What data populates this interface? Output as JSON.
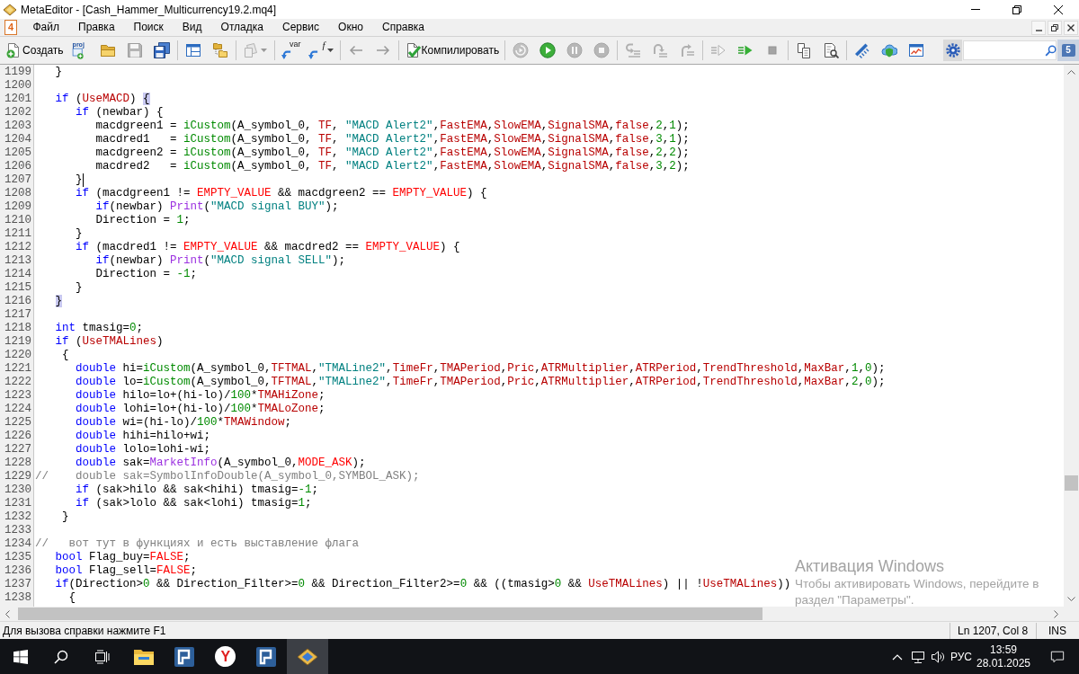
{
  "window": {
    "title": "MetaEditor - [Cash_Hammer_Multicurrency19.2.mq4]"
  },
  "menu_bar": {
    "document_glyph": "4",
    "items": [
      "Файл",
      "Правка",
      "Поиск",
      "Вид",
      "Отладка",
      "Сервис",
      "Окно",
      "Справка"
    ]
  },
  "toolbar": {
    "groups": [
      [
        {
          "kind": "new",
          "label": "Создать",
          "disabled": false
        },
        {
          "kind": "project",
          "glyph": "proj",
          "disabled": false
        },
        {
          "kind": "open",
          "disabled": false
        },
        {
          "kind": "save",
          "disabled": true
        },
        {
          "kind": "saveall",
          "disabled": false
        }
      ],
      [
        {
          "kind": "navigator",
          "disabled": false
        },
        {
          "kind": "folders",
          "disabled": false
        }
      ],
      [
        {
          "kind": "clipboard",
          "disabled": true
        }
      ],
      [
        {
          "kind": "variable",
          "glyph": "var",
          "disabled": false
        },
        {
          "kind": "function",
          "glyph": "f",
          "disabled": false
        }
      ],
      [
        {
          "kind": "back",
          "disabled": true
        },
        {
          "kind": "forward",
          "disabled": true
        }
      ],
      [
        {
          "kind": "compile",
          "label": "Компилировать",
          "disabled": false
        }
      ],
      [
        {
          "kind": "restart",
          "disabled": true
        },
        {
          "kind": "start",
          "disabled": false
        },
        {
          "kind": "pause",
          "disabled": true
        },
        {
          "kind": "stop",
          "disabled": true
        }
      ],
      [
        {
          "kind": "stepinto",
          "disabled": true
        },
        {
          "kind": "stepover",
          "disabled": true
        },
        {
          "kind": "stepout",
          "disabled": true
        }
      ],
      [
        {
          "kind": "profile",
          "disabled": true
        },
        {
          "kind": "run",
          "disabled": false
        },
        {
          "kind": "halt",
          "disabled": true
        }
      ],
      [
        {
          "kind": "copy",
          "disabled": false
        },
        {
          "kind": "inspect",
          "disabled": false
        }
      ],
      [
        {
          "kind": "styler",
          "disabled": false
        },
        {
          "kind": "cloud",
          "disabled": false
        },
        {
          "kind": "chart",
          "disabled": false
        }
      ]
    ],
    "chat_glyph": "5"
  },
  "editor": {
    "lines": [
      {
        "number": "1199",
        "tokens": [
          {
            "text": "   }",
            "kind": "plain"
          }
        ]
      },
      {
        "number": "1200"
      },
      {
        "number": "1201",
        "tokens": [
          {
            "text": "   if",
            "kind": "keyword"
          },
          {
            "text": " (",
            "kind": "plain"
          },
          {
            "text": "UseMACD",
            "kind": "param"
          },
          {
            "text": ") ",
            "kind": "plain"
          },
          {
            "text": "{",
            "kind": "brace_match"
          }
        ]
      },
      {
        "number": "1202",
        "tokens": [
          {
            "text": "      if",
            "kind": "keyword"
          },
          {
            "text": " (newbar) {",
            "kind": "plain"
          }
        ]
      },
      {
        "number": "1203",
        "tokens": [
          {
            "text": "         macdgreen1 = ",
            "kind": "plain"
          },
          {
            "text": "iCustom",
            "kind": "function"
          },
          {
            "text": "(A_symbol_0, ",
            "kind": "plain"
          },
          {
            "text": "TF",
            "kind": "param"
          },
          {
            "text": ", ",
            "kind": "plain"
          },
          {
            "text": "\"MACD Alert2\"",
            "kind": "string"
          },
          {
            "text": ",",
            "kind": "plain"
          },
          {
            "text": "FastEMA",
            "kind": "param"
          },
          {
            "text": ",",
            "kind": "plain"
          },
          {
            "text": "SlowEMA",
            "kind": "param"
          },
          {
            "text": ",",
            "kind": "plain"
          },
          {
            "text": "SignalSMA",
            "kind": "param"
          },
          {
            "text": ",",
            "kind": "plain"
          },
          {
            "text": "false",
            "kind": "param"
          },
          {
            "text": ",",
            "kind": "plain"
          },
          {
            "text": "2",
            "kind": "number"
          },
          {
            "text": ",",
            "kind": "plain"
          },
          {
            "text": "1",
            "kind": "number"
          },
          {
            "text": ");",
            "kind": "plain"
          }
        ]
      },
      {
        "number": "1204",
        "tokens": [
          {
            "text": "         macdred1   = ",
            "kind": "plain"
          },
          {
            "text": "iCustom",
            "kind": "function"
          },
          {
            "text": "(A_symbol_0, ",
            "kind": "plain"
          },
          {
            "text": "TF",
            "kind": "param"
          },
          {
            "text": ", ",
            "kind": "plain"
          },
          {
            "text": "\"MACD Alert2\"",
            "kind": "string"
          },
          {
            "text": ",",
            "kind": "plain"
          },
          {
            "text": "FastEMA",
            "kind": "param"
          },
          {
            "text": ",",
            "kind": "plain"
          },
          {
            "text": "SlowEMA",
            "kind": "param"
          },
          {
            "text": ",",
            "kind": "plain"
          },
          {
            "text": "SignalSMA",
            "kind": "param"
          },
          {
            "text": ",",
            "kind": "plain"
          },
          {
            "text": "false",
            "kind": "param"
          },
          {
            "text": ",",
            "kind": "plain"
          },
          {
            "text": "3",
            "kind": "number"
          },
          {
            "text": ",",
            "kind": "plain"
          },
          {
            "text": "1",
            "kind": "number"
          },
          {
            "text": ");",
            "kind": "plain"
          }
        ]
      },
      {
        "number": "1205",
        "tokens": [
          {
            "text": "         macdgreen2 = ",
            "kind": "plain"
          },
          {
            "text": "iCustom",
            "kind": "function"
          },
          {
            "text": "(A_symbol_0, ",
            "kind": "plain"
          },
          {
            "text": "TF",
            "kind": "param"
          },
          {
            "text": ", ",
            "kind": "plain"
          },
          {
            "text": "\"MACD Alert2\"",
            "kind": "string"
          },
          {
            "text": ",",
            "kind": "plain"
          },
          {
            "text": "FastEMA",
            "kind": "param"
          },
          {
            "text": ",",
            "kind": "plain"
          },
          {
            "text": "SlowEMA",
            "kind": "param"
          },
          {
            "text": ",",
            "kind": "plain"
          },
          {
            "text": "SignalSMA",
            "kind": "param"
          },
          {
            "text": ",",
            "kind": "plain"
          },
          {
            "text": "false",
            "kind": "param"
          },
          {
            "text": ",",
            "kind": "plain"
          },
          {
            "text": "2",
            "kind": "number"
          },
          {
            "text": ",",
            "kind": "plain"
          },
          {
            "text": "2",
            "kind": "number"
          },
          {
            "text": ");",
            "kind": "plain"
          }
        ]
      },
      {
        "number": "1206",
        "tokens": [
          {
            "text": "         macdred2   = ",
            "kind": "plain"
          },
          {
            "text": "iCustom",
            "kind": "function"
          },
          {
            "text": "(A_symbol_0, ",
            "kind": "plain"
          },
          {
            "text": "TF",
            "kind": "param"
          },
          {
            "text": ", ",
            "kind": "plain"
          },
          {
            "text": "\"MACD Alert2\"",
            "kind": "string"
          },
          {
            "text": ",",
            "kind": "plain"
          },
          {
            "text": "FastEMA",
            "kind": "param"
          },
          {
            "text": ",",
            "kind": "plain"
          },
          {
            "text": "SlowEMA",
            "kind": "param"
          },
          {
            "text": ",",
            "kind": "plain"
          },
          {
            "text": "SignalSMA",
            "kind": "param"
          },
          {
            "text": ",",
            "kind": "plain"
          },
          {
            "text": "false",
            "kind": "param"
          },
          {
            "text": ",",
            "kind": "plain"
          },
          {
            "text": "3",
            "kind": "number"
          },
          {
            "text": ",",
            "kind": "plain"
          },
          {
            "text": "2",
            "kind": "number"
          },
          {
            "text": ");",
            "kind": "plain"
          }
        ]
      },
      {
        "number": "1207",
        "tokens": [
          {
            "text": "      }",
            "kind": "plain"
          },
          {
            "kind": "caret"
          }
        ]
      },
      {
        "number": "1208",
        "tokens": [
          {
            "text": "      if",
            "kind": "keyword"
          },
          {
            "text": " (macdgreen1 != ",
            "kind": "plain"
          },
          {
            "text": "EMPTY_VALUE",
            "kind": "constant"
          },
          {
            "text": " && macdgreen2 == ",
            "kind": "plain"
          },
          {
            "text": "EMPTY_VALUE",
            "kind": "constant"
          },
          {
            "text": ") {",
            "kind": "plain"
          }
        ]
      },
      {
        "number": "1209",
        "tokens": [
          {
            "text": "         if",
            "kind": "keyword"
          },
          {
            "text": "(newbar) ",
            "kind": "plain"
          },
          {
            "text": "Print",
            "kind": "builtin"
          },
          {
            "text": "(",
            "kind": "plain"
          },
          {
            "text": "\"MACD signal BUY\"",
            "kind": "string"
          },
          {
            "text": ");",
            "kind": "plain"
          }
        ]
      },
      {
        "number": "1210",
        "tokens": [
          {
            "text": "         Direction = ",
            "kind": "plain"
          },
          {
            "text": "1",
            "kind": "number"
          },
          {
            "text": ";",
            "kind": "plain"
          }
        ]
      },
      {
        "number": "1211",
        "tokens": [
          {
            "text": "      }",
            "kind": "plain"
          }
        ]
      },
      {
        "number": "1212",
        "tokens": [
          {
            "text": "      if",
            "kind": "keyword"
          },
          {
            "text": " (macdred1 != ",
            "kind": "plain"
          },
          {
            "text": "EMPTY_VALUE",
            "kind": "constant"
          },
          {
            "text": " && macdred2 == ",
            "kind": "plain"
          },
          {
            "text": "EMPTY_VALUE",
            "kind": "constant"
          },
          {
            "text": ") {",
            "kind": "plain"
          }
        ]
      },
      {
        "number": "1213",
        "tokens": [
          {
            "text": "         if",
            "kind": "keyword"
          },
          {
            "text": "(newbar) ",
            "kind": "plain"
          },
          {
            "text": "Print",
            "kind": "builtin"
          },
          {
            "text": "(",
            "kind": "plain"
          },
          {
            "text": "\"MACD signal SELL\"",
            "kind": "string"
          },
          {
            "text": ");",
            "kind": "plain"
          }
        ]
      },
      {
        "number": "1214",
        "tokens": [
          {
            "text": "         Direction = ",
            "kind": "plain"
          },
          {
            "text": "-1",
            "kind": "number"
          },
          {
            "text": ";",
            "kind": "plain"
          }
        ]
      },
      {
        "number": "1215",
        "tokens": [
          {
            "text": "      }",
            "kind": "plain"
          }
        ]
      },
      {
        "number": "1216",
        "tokens": [
          {
            "text": "   }",
            "kind": "brace_match"
          }
        ]
      },
      {
        "number": "1217"
      },
      {
        "number": "1218",
        "tokens": [
          {
            "text": "   int",
            "kind": "keyword"
          },
          {
            "text": " tmasig=",
            "kind": "plain"
          },
          {
            "text": "0",
            "kind": "number"
          },
          {
            "text": ";",
            "kind": "plain"
          }
        ]
      },
      {
        "number": "1219",
        "tokens": [
          {
            "text": "   if",
            "kind": "keyword"
          },
          {
            "text": " (",
            "kind": "plain"
          },
          {
            "text": "UseTMALines",
            "kind": "param"
          },
          {
            "text": ")",
            "kind": "plain"
          }
        ]
      },
      {
        "number": "1220",
        "tokens": [
          {
            "text": "    {",
            "kind": "plain"
          }
        ]
      },
      {
        "number": "1221",
        "tokens": [
          {
            "text": "      double",
            "kind": "keyword"
          },
          {
            "text": " hi=",
            "kind": "plain"
          },
          {
            "text": "iCustom",
            "kind": "function"
          },
          {
            "text": "(A_symbol_0,",
            "kind": "plain"
          },
          {
            "text": "TFTMAL",
            "kind": "param"
          },
          {
            "text": ",",
            "kind": "plain"
          },
          {
            "text": "\"TMALine2\"",
            "kind": "string"
          },
          {
            "text": ",",
            "kind": "plain"
          },
          {
            "text": "TimeFr",
            "kind": "param"
          },
          {
            "text": ",",
            "kind": "plain"
          },
          {
            "text": "TMAPeriod",
            "kind": "param"
          },
          {
            "text": ",",
            "kind": "plain"
          },
          {
            "text": "Pric",
            "kind": "param"
          },
          {
            "text": ",",
            "kind": "plain"
          },
          {
            "text": "ATRMultiplier",
            "kind": "param"
          },
          {
            "text": ",",
            "kind": "plain"
          },
          {
            "text": "ATRPeriod",
            "kind": "param"
          },
          {
            "text": ",",
            "kind": "plain"
          },
          {
            "text": "TrendThreshold",
            "kind": "param"
          },
          {
            "text": ",",
            "kind": "plain"
          },
          {
            "text": "MaxBar",
            "kind": "param"
          },
          {
            "text": ",",
            "kind": "plain"
          },
          {
            "text": "1",
            "kind": "number"
          },
          {
            "text": ",",
            "kind": "plain"
          },
          {
            "text": "0",
            "kind": "number"
          },
          {
            "text": ");",
            "kind": "plain"
          }
        ]
      },
      {
        "number": "1222",
        "tokens": [
          {
            "text": "      double",
            "kind": "keyword"
          },
          {
            "text": " lo=",
            "kind": "plain"
          },
          {
            "text": "iCustom",
            "kind": "function"
          },
          {
            "text": "(A_symbol_0,",
            "kind": "plain"
          },
          {
            "text": "TFTMAL",
            "kind": "param"
          },
          {
            "text": ",",
            "kind": "plain"
          },
          {
            "text": "\"TMALine2\"",
            "kind": "string"
          },
          {
            "text": ",",
            "kind": "plain"
          },
          {
            "text": "TimeFr",
            "kind": "param"
          },
          {
            "text": ",",
            "kind": "plain"
          },
          {
            "text": "TMAPeriod",
            "kind": "param"
          },
          {
            "text": ",",
            "kind": "plain"
          },
          {
            "text": "Pric",
            "kind": "param"
          },
          {
            "text": ",",
            "kind": "plain"
          },
          {
            "text": "ATRMultiplier",
            "kind": "param"
          },
          {
            "text": ",",
            "kind": "plain"
          },
          {
            "text": "ATRPeriod",
            "kind": "param"
          },
          {
            "text": ",",
            "kind": "plain"
          },
          {
            "text": "TrendThreshold",
            "kind": "param"
          },
          {
            "text": ",",
            "kind": "plain"
          },
          {
            "text": "MaxBar",
            "kind": "param"
          },
          {
            "text": ",",
            "kind": "plain"
          },
          {
            "text": "2",
            "kind": "number"
          },
          {
            "text": ",",
            "kind": "plain"
          },
          {
            "text": "0",
            "kind": "number"
          },
          {
            "text": ");",
            "kind": "plain"
          }
        ]
      },
      {
        "number": "1223",
        "tokens": [
          {
            "text": "      double",
            "kind": "keyword"
          },
          {
            "text": " hilo=lo+(hi-lo)/",
            "kind": "plain"
          },
          {
            "text": "100",
            "kind": "number"
          },
          {
            "text": "*",
            "kind": "plain"
          },
          {
            "text": "TMAHiZone",
            "kind": "param"
          },
          {
            "text": ";",
            "kind": "plain"
          }
        ]
      },
      {
        "number": "1224",
        "tokens": [
          {
            "text": "      double",
            "kind": "keyword"
          },
          {
            "text": " lohi=lo+(hi-lo)/",
            "kind": "plain"
          },
          {
            "text": "100",
            "kind": "number"
          },
          {
            "text": "*",
            "kind": "plain"
          },
          {
            "text": "TMALoZone",
            "kind": "param"
          },
          {
            "text": ";",
            "kind": "plain"
          }
        ]
      },
      {
        "number": "1225",
        "tokens": [
          {
            "text": "      double",
            "kind": "keyword"
          },
          {
            "text": " wi=(hi-lo)/",
            "kind": "plain"
          },
          {
            "text": "100",
            "kind": "number"
          },
          {
            "text": "*",
            "kind": "plain"
          },
          {
            "text": "TMAWindow",
            "kind": "param"
          },
          {
            "text": ";",
            "kind": "plain"
          }
        ]
      },
      {
        "number": "1226",
        "tokens": [
          {
            "text": "      double",
            "kind": "keyword"
          },
          {
            "text": " hihi=hilo+wi;",
            "kind": "plain"
          }
        ]
      },
      {
        "number": "1227",
        "tokens": [
          {
            "text": "      double",
            "kind": "keyword"
          },
          {
            "text": " lolo=lohi-wi;",
            "kind": "plain"
          }
        ]
      },
      {
        "number": "1228",
        "tokens": [
          {
            "text": "      double",
            "kind": "keyword"
          },
          {
            "text": " sak=",
            "kind": "plain"
          },
          {
            "text": "MarketInfo",
            "kind": "builtin"
          },
          {
            "text": "(A_symbol_0,",
            "kind": "plain"
          },
          {
            "text": "MODE_ASK",
            "kind": "constant"
          },
          {
            "text": ");",
            "kind": "plain"
          }
        ]
      },
      {
        "number": "1229",
        "tokens": [
          {
            "text": "//    double sak=SymbolInfoDouble(A_symbol_0,SYMBOL_ASK);",
            "kind": "comment"
          }
        ]
      },
      {
        "number": "1230",
        "tokens": [
          {
            "text": "      if",
            "kind": "keyword"
          },
          {
            "text": " (sak>hilo && sak<hihi) tmasig=",
            "kind": "plain"
          },
          {
            "text": "-1",
            "kind": "number"
          },
          {
            "text": ";",
            "kind": "plain"
          }
        ]
      },
      {
        "number": "1231",
        "tokens": [
          {
            "text": "      if",
            "kind": "keyword"
          },
          {
            "text": " (sak>lolo && sak<lohi) tmasig=",
            "kind": "plain"
          },
          {
            "text": "1",
            "kind": "number"
          },
          {
            "text": ";",
            "kind": "plain"
          }
        ]
      },
      {
        "number": "1232",
        "tokens": [
          {
            "text": "    }",
            "kind": "plain"
          }
        ]
      },
      {
        "number": "1233"
      },
      {
        "number": "1234",
        "tokens": [
          {
            "text": "//   вот тут в функциях и есть выставление флага",
            "kind": "comment"
          }
        ]
      },
      {
        "number": "1235",
        "tokens": [
          {
            "text": "   bool",
            "kind": "keyword"
          },
          {
            "text": " Flag_buy=",
            "kind": "plain"
          },
          {
            "text": "FALSE",
            "kind": "constant"
          },
          {
            "text": ";",
            "kind": "plain"
          }
        ]
      },
      {
        "number": "1236",
        "tokens": [
          {
            "text": "   bool",
            "kind": "keyword"
          },
          {
            "text": " Flag_sell=",
            "kind": "plain"
          },
          {
            "text": "FALSE",
            "kind": "constant"
          },
          {
            "text": ";",
            "kind": "plain"
          }
        ]
      },
      {
        "number": "1237",
        "tokens": [
          {
            "text": "   if",
            "kind": "keyword"
          },
          {
            "text": "(Direction>",
            "kind": "plain"
          },
          {
            "text": "0",
            "kind": "number"
          },
          {
            "text": " && Direction_Filter>=",
            "kind": "plain"
          },
          {
            "text": "0",
            "kind": "number"
          },
          {
            "text": " && Direction_Filter2>=",
            "kind": "plain"
          },
          {
            "text": "0",
            "kind": "number"
          },
          {
            "text": " && ((tmasig>",
            "kind": "plain"
          },
          {
            "text": "0",
            "kind": "number"
          },
          {
            "text": " && ",
            "kind": "plain"
          },
          {
            "text": "UseTMALines",
            "kind": "param"
          },
          {
            "text": ") || !",
            "kind": "plain"
          },
          {
            "text": "UseTMALines",
            "kind": "param"
          },
          {
            "text": "))",
            "kind": "plain"
          }
        ]
      },
      {
        "number": "1238",
        "tokens": [
          {
            "text": "     {",
            "kind": "plain"
          }
        ]
      }
    ]
  },
  "activation_notice": {
    "title": "Активация Windows",
    "lines": [
      "Чтобы активировать Windows, перейдите в",
      "раздел \"Параметры\"."
    ]
  },
  "status_bar": {
    "hint": "Для вызова справки нажмите F1",
    "position": "Ln 1207, Col 8",
    "mode": "INS"
  },
  "taskbar": {
    "apps": [
      {
        "kind": "explorer",
        "selected": false
      },
      {
        "kind": "terminal",
        "selected": false
      },
      {
        "kind": "browser",
        "glyph": "Y",
        "selected": false
      },
      {
        "kind": "terminal",
        "selected": false
      },
      {
        "kind": "editor",
        "selected": true
      }
    ],
    "language": "РУС",
    "time": "13:59",
    "date": "28.01.2025"
  }
}
